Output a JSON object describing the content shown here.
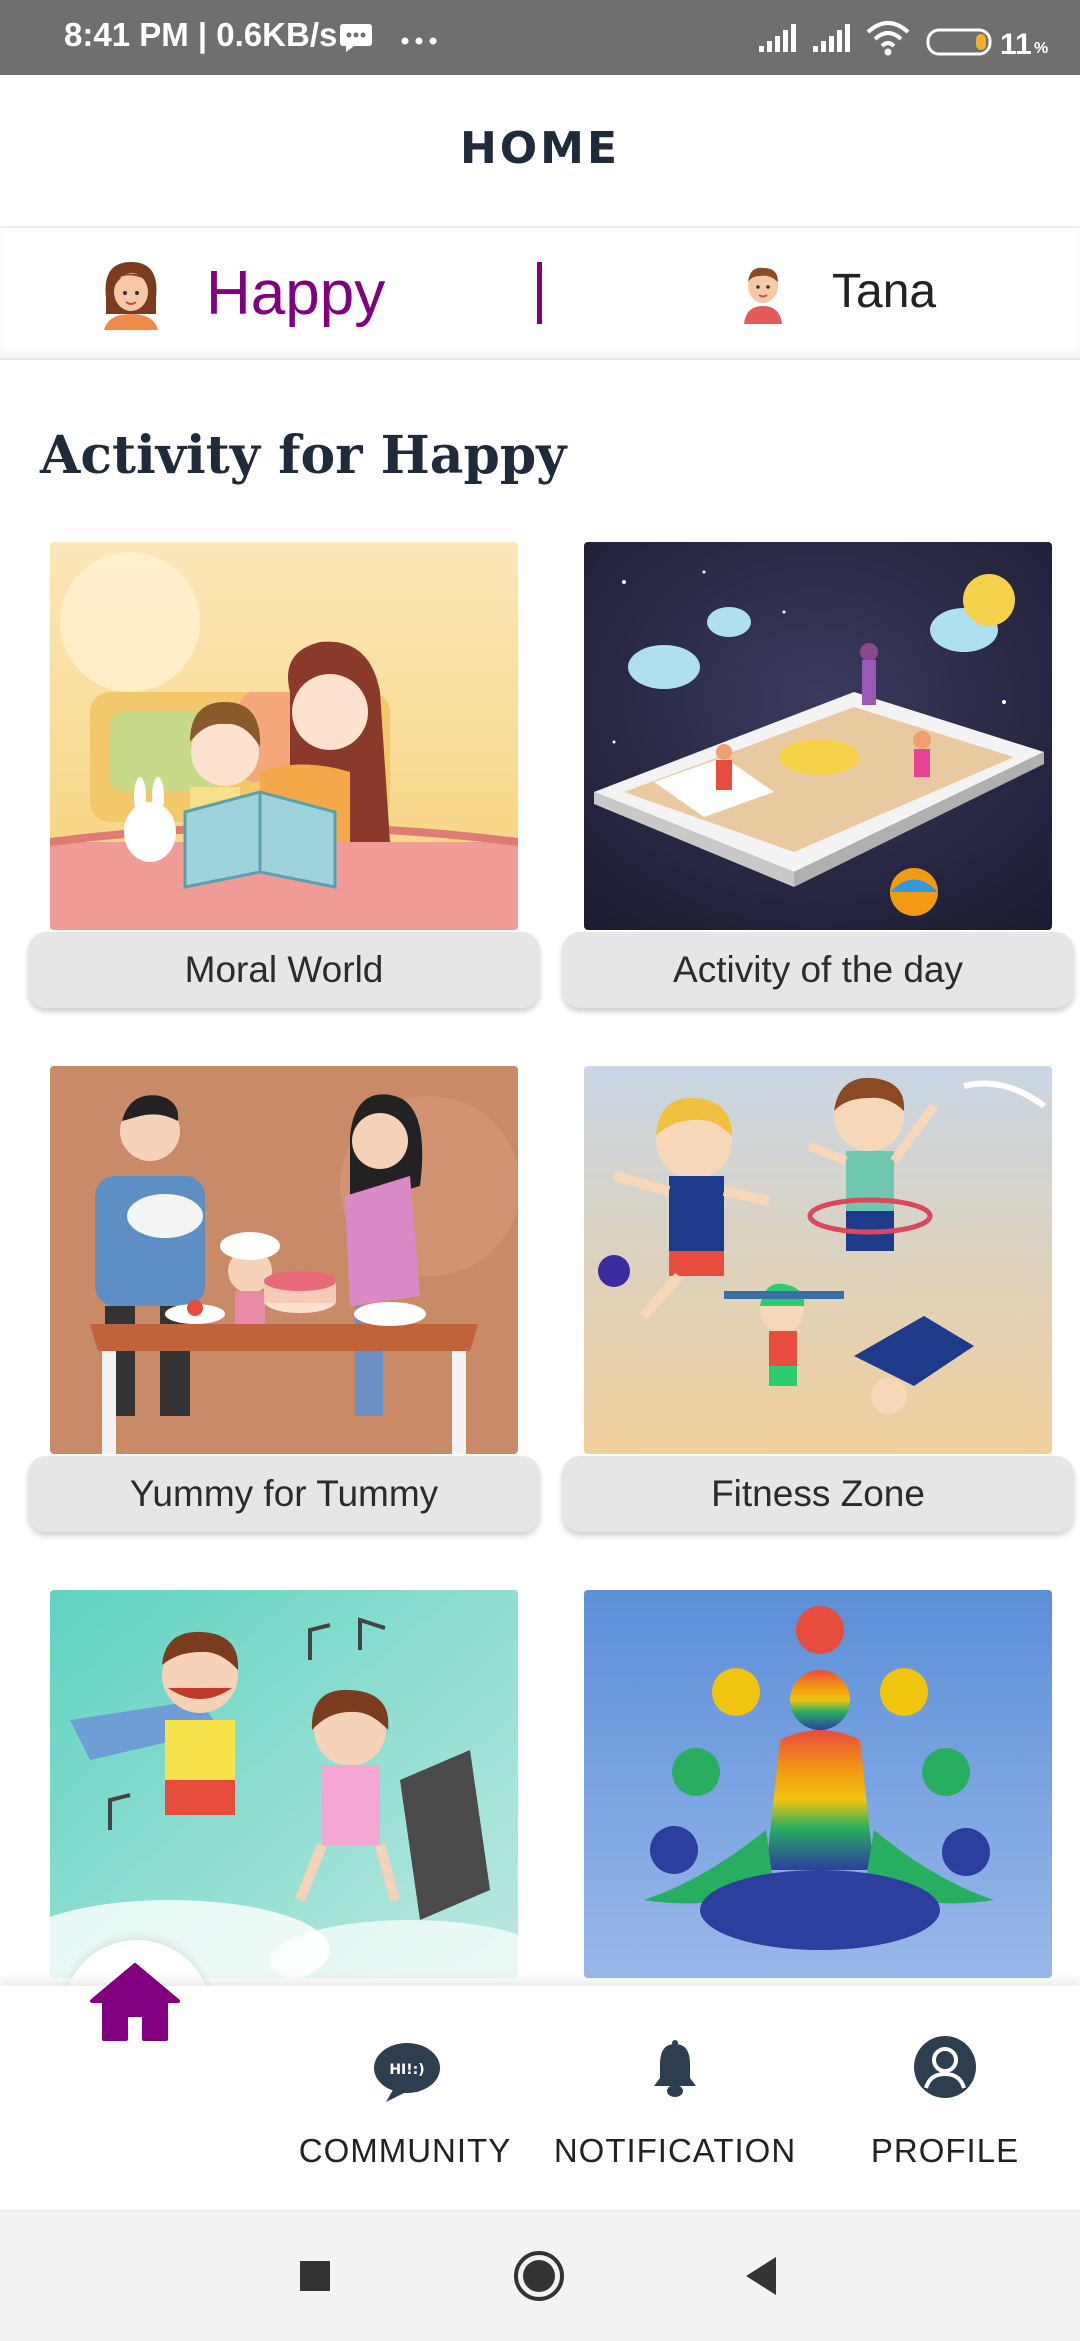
{
  "status_bar": {
    "time": "8:41 PM | 0.6KB/s",
    "battery": "11"
  },
  "header": {
    "title": "HOME"
  },
  "kids": {
    "selected": "Happy",
    "other": "Tana"
  },
  "section": {
    "title": "Activity for Happy"
  },
  "activities": [
    {
      "label": "Moral World"
    },
    {
      "label": "Activity of the day"
    },
    {
      "label": "Yummy for Tummy"
    },
    {
      "label": "Fitness Zone"
    }
  ],
  "bottom_nav": {
    "community": "COMMUNITY",
    "notification": "NOTIFICATION",
    "profile": "PROFILE"
  },
  "colors": {
    "accent": "#800080",
    "status_bar": "#6f6f6f"
  }
}
